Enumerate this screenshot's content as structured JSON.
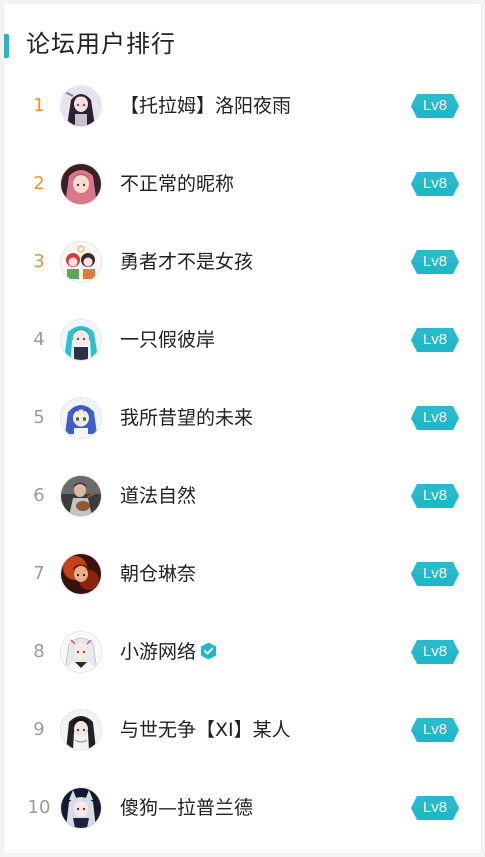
{
  "panel": {
    "title": "论坛用户排行",
    "accent_color": "#20b7c9",
    "top_rank_color": "#f0922f"
  },
  "users": [
    {
      "rank": "1",
      "name": "【托拉姆】洛阳夜雨",
      "level": "Lv8",
      "verified": false,
      "avatar": "avatar-gothic-girl"
    },
    {
      "rank": "2",
      "name": "不正常的昵称",
      "level": "Lv8",
      "verified": false,
      "avatar": "avatar-pink-hair"
    },
    {
      "rank": "3",
      "name": "勇者才不是女孩",
      "level": "Lv8",
      "verified": false,
      "avatar": "avatar-chibi-group"
    },
    {
      "rank": "4",
      "name": "一只假彼岸",
      "level": "Lv8",
      "verified": false,
      "avatar": "avatar-teal-twintails"
    },
    {
      "rank": "5",
      "name": "我所昔望的未来",
      "level": "Lv8",
      "verified": false,
      "avatar": "avatar-blue-hair"
    },
    {
      "rank": "6",
      "name": "道法自然",
      "level": "Lv8",
      "verified": false,
      "avatar": "avatar-guitarist"
    },
    {
      "rank": "7",
      "name": "朝仓琳奈",
      "level": "Lv8",
      "verified": false,
      "avatar": "avatar-red-fire"
    },
    {
      "rank": "8",
      "name": "小游网络",
      "level": "Lv8",
      "verified": true,
      "avatar": "avatar-white-hair"
    },
    {
      "rank": "9",
      "name": "与世无争【XI】某人",
      "level": "Lv8",
      "verified": false,
      "avatar": "avatar-dark-hair"
    },
    {
      "rank": "10",
      "name": "傻狗—拉普兰德",
      "level": "Lv8",
      "verified": false,
      "avatar": "avatar-wolf-girl"
    }
  ]
}
